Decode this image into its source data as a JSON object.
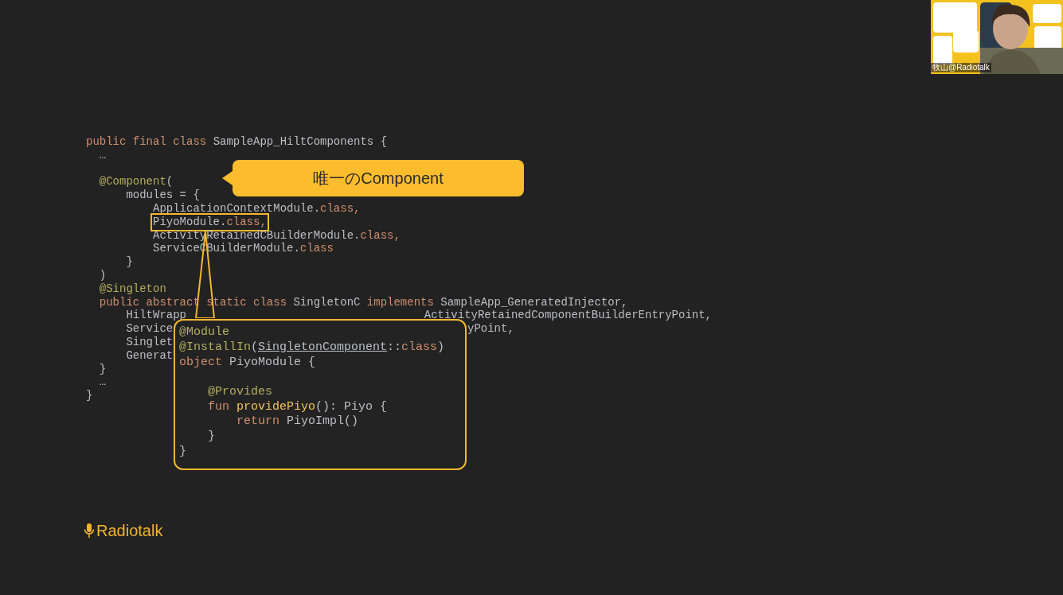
{
  "code": {
    "lines": [
      {
        "kind": "code",
        "tokens": [
          {
            "text": "public final class ",
            "kind": "keyword"
          },
          {
            "text": "SampleApp_HiltComponents {",
            "kind": "plain"
          }
        ],
        "children": [
          {
            "kind": "code",
            "tokens": [
              {
                "text": "…",
                "kind": "plain"
              }
            ]
          },
          {
            "kind": "blank"
          },
          {
            "kind": "code",
            "tokens": [
              {
                "text": "@Component",
                "kind": "annotation"
              },
              {
                "text": "(",
                "kind": "plain"
              }
            ],
            "children": [
              {
                "kind": "code",
                "tokens": [
                  {
                    "text": "modules = {",
                    "kind": "plain"
                  }
                ],
                "children": [
                  {
                    "kind": "code",
                    "tokens": [
                      {
                        "text": "ApplicationContextModule.",
                        "kind": "plain"
                      },
                      {
                        "text": "class",
                        "kind": "keyword"
                      },
                      {
                        "text": ",",
                        "kind": "keyword"
                      }
                    ]
                  },
                  {
                    "kind": "code",
                    "highlighted": true,
                    "tokens": [
                      {
                        "text": "PiyoModule.",
                        "kind": "plain"
                      },
                      {
                        "text": "class",
                        "kind": "keyword"
                      },
                      {
                        "text": ",",
                        "kind": "keyword"
                      }
                    ]
                  },
                  {
                    "kind": "code",
                    "highlighted": false,
                    "tokens": [
                      {
                        "text": "ActivityRetainedCBuilderModule.",
                        "kind": "plain"
                      },
                      {
                        "text": "class",
                        "kind": "keyword"
                      },
                      {
                        "text": ",",
                        "kind": "keyword"
                      }
                    ]
                  },
                  {
                    "kind": "code",
                    "tokens": [
                      {
                        "text": "ServiceCBuilderModule.",
                        "kind": "plain"
                      },
                      {
                        "text": "class",
                        "kind": "keyword"
                      }
                    ]
                  }
                ]
              },
              {
                "kind": "code",
                "tokens": [
                  {
                    "text": "}",
                    "kind": "plain"
                  }
                ]
              }
            ]
          },
          {
            "kind": "code",
            "tokens": [
              {
                "text": ")",
                "kind": "plain"
              }
            ]
          },
          {
            "kind": "code",
            "tokens": [
              {
                "text": "@Singleton",
                "kind": "annotation"
              }
            ]
          },
          {
            "kind": "code",
            "tokens": [
              {
                "text": "public abstract static class ",
                "kind": "keyword"
              },
              {
                "text": "SingletonC ",
                "kind": "plain"
              },
              {
                "text": "implements ",
                "kind": "keyword"
              },
              {
                "text": "SampleApp_GeneratedInjector,",
                "kind": "plain"
              }
            ],
            "children": [
              {
                "kind": "code",
                "tokens": [
                  {
                    "text": "HiltWrapp",
                    "kind": "plain"
                  },
                  {
                    "text": "ActivityRetainedComponentBuilderEntryPoint,",
                    "kind": "plain",
                    "obscured_before": true
                  }
                ]
              },
              {
                "kind": "code",
                "tokens": [
                  {
                    "text": "Service",
                    "kind": "plain"
                  },
                  {
                    "text": "yPoint,",
                    "kind": "plain",
                    "obscured_before": true
                  }
                ]
              },
              {
                "kind": "code",
                "tokens": [
                  {
                    "text": "Singlet",
                    "kind": "plain"
                  }
                ]
              },
              {
                "kind": "code",
                "tokens": [
                  {
                    "text": "Generat",
                    "kind": "plain"
                  }
                ]
              }
            ]
          },
          {
            "kind": "code",
            "tokens": [
              {
                "text": "}",
                "kind": "plain"
              }
            ]
          },
          {
            "kind": "code",
            "tokens": [
              {
                "text": "…",
                "kind": "plain"
              }
            ]
          }
        ]
      },
      {
        "kind": "code",
        "tokens": [
          {
            "text": "}",
            "kind": "plain"
          }
        ]
      }
    ]
  },
  "callout": {
    "text": "唯一のComponent"
  },
  "popup": {
    "lines": [
      {
        "kind": "code",
        "tokens": [
          {
            "text": "@Module",
            "kind": "annotation"
          }
        ]
      },
      {
        "kind": "code",
        "tokens": [
          {
            "text": "@InstallIn",
            "kind": "annotation"
          },
          {
            "text": "(",
            "kind": "plain"
          },
          {
            "text": "SingletonComponent",
            "kind": "link"
          },
          {
            "text": "::",
            "kind": "plain"
          },
          {
            "text": "class",
            "kind": "keyword"
          },
          {
            "text": ")",
            "kind": "plain"
          }
        ]
      },
      {
        "kind": "code",
        "tokens": [
          {
            "text": "object ",
            "kind": "keyword"
          },
          {
            "text": "PiyoModule {",
            "kind": "plain"
          }
        ],
        "children": [
          {
            "kind": "blank"
          },
          {
            "kind": "code",
            "tokens": [
              {
                "text": "@Provides",
                "kind": "annotation"
              }
            ]
          },
          {
            "kind": "code",
            "tokens": [
              {
                "text": "fun ",
                "kind": "keyword"
              },
              {
                "text": "providePiyo",
                "kind": "function"
              },
              {
                "text": "(): Piyo {",
                "kind": "plain"
              }
            ],
            "children": [
              {
                "kind": "code",
                "tokens": [
                  {
                    "text": "return ",
                    "kind": "keyword"
                  },
                  {
                    "text": "PiyoImpl()",
                    "kind": "plain"
                  }
                ]
              }
            ]
          },
          {
            "kind": "code",
            "tokens": [
              {
                "text": "}",
                "kind": "plain"
              }
            ]
          }
        ]
      },
      {
        "kind": "code",
        "tokens": [
          {
            "text": "}",
            "kind": "plain"
          }
        ]
      }
    ]
  },
  "logo": {
    "text": "Radiotalk"
  },
  "webcam": {
    "kind": "picture",
    "name": "牧山@Radiotalk"
  }
}
